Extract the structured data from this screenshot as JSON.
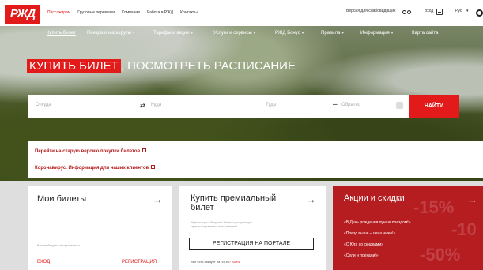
{
  "header": {
    "logo": "РЖД",
    "nav": [
      "Пассажирам",
      "Грузовые перевозки",
      "Компания",
      "Работа в РЖД",
      "Контакты"
    ],
    "nav_active_index": 0,
    "accessibility_label": "Версия для слабовидящих",
    "login_label": "Вход",
    "lang_label": "Рус"
  },
  "subnav": {
    "items": [
      {
        "label": "Купить билет",
        "dropdown": false
      },
      {
        "label": "Поезда и маршруты",
        "dropdown": true
      },
      {
        "label": "Тарифы и акции",
        "dropdown": true
      },
      {
        "label": "Услуги и сервисы",
        "dropdown": true
      },
      {
        "label": "РЖД Бонус",
        "dropdown": true
      },
      {
        "label": "Правила",
        "dropdown": true
      },
      {
        "label": "Информация",
        "dropdown": true
      },
      {
        "label": "Карта сайта",
        "dropdown": false
      }
    ]
  },
  "hero": {
    "title_highlight": "КУПИТЬ БИЛЕТ",
    "title_rest": ", ПОСМОТРЕТЬ РАСПИСАНИЕ"
  },
  "search": {
    "from_placeholder": "Откуда",
    "swap_icon": "⇄",
    "to_placeholder": "Куда",
    "date_placeholder": "Туда",
    "date_sep": "–",
    "back_placeholder": "Обратно",
    "button": "НАЙТИ"
  },
  "notices": [
    "Перейти на старую версию покупки билетов",
    "Коронавирус. Информация для наших клиентов"
  ],
  "cards": {
    "tickets": {
      "title": "Мои билеты",
      "hint": "Вам необходимо авторизоваться",
      "login": "ВХОД",
      "register": "РЕГИСТРАЦИЯ"
    },
    "premium": {
      "title": "Купить премиальный билет",
      "hint": "Информация о бонусных билетах доступна для зарегистрированных пользователей",
      "button": "РЕГИСТРАЦИЯ НА ПОРТАЛЕ",
      "account_text": "Уже есть аккаунт на rzd.ru?",
      "account_link": "Войти"
    },
    "promo": {
      "title": "Акции и скидки",
      "items": [
        "«В День рождения лучше поездом!»",
        "«Поезд выше – цена ниже!»",
        "«С Юга со скидками»",
        "«Сели и поехали!»"
      ]
    }
  },
  "colors": {
    "brand_red": "#e21a1a",
    "promo_bg": "#b51d21"
  }
}
